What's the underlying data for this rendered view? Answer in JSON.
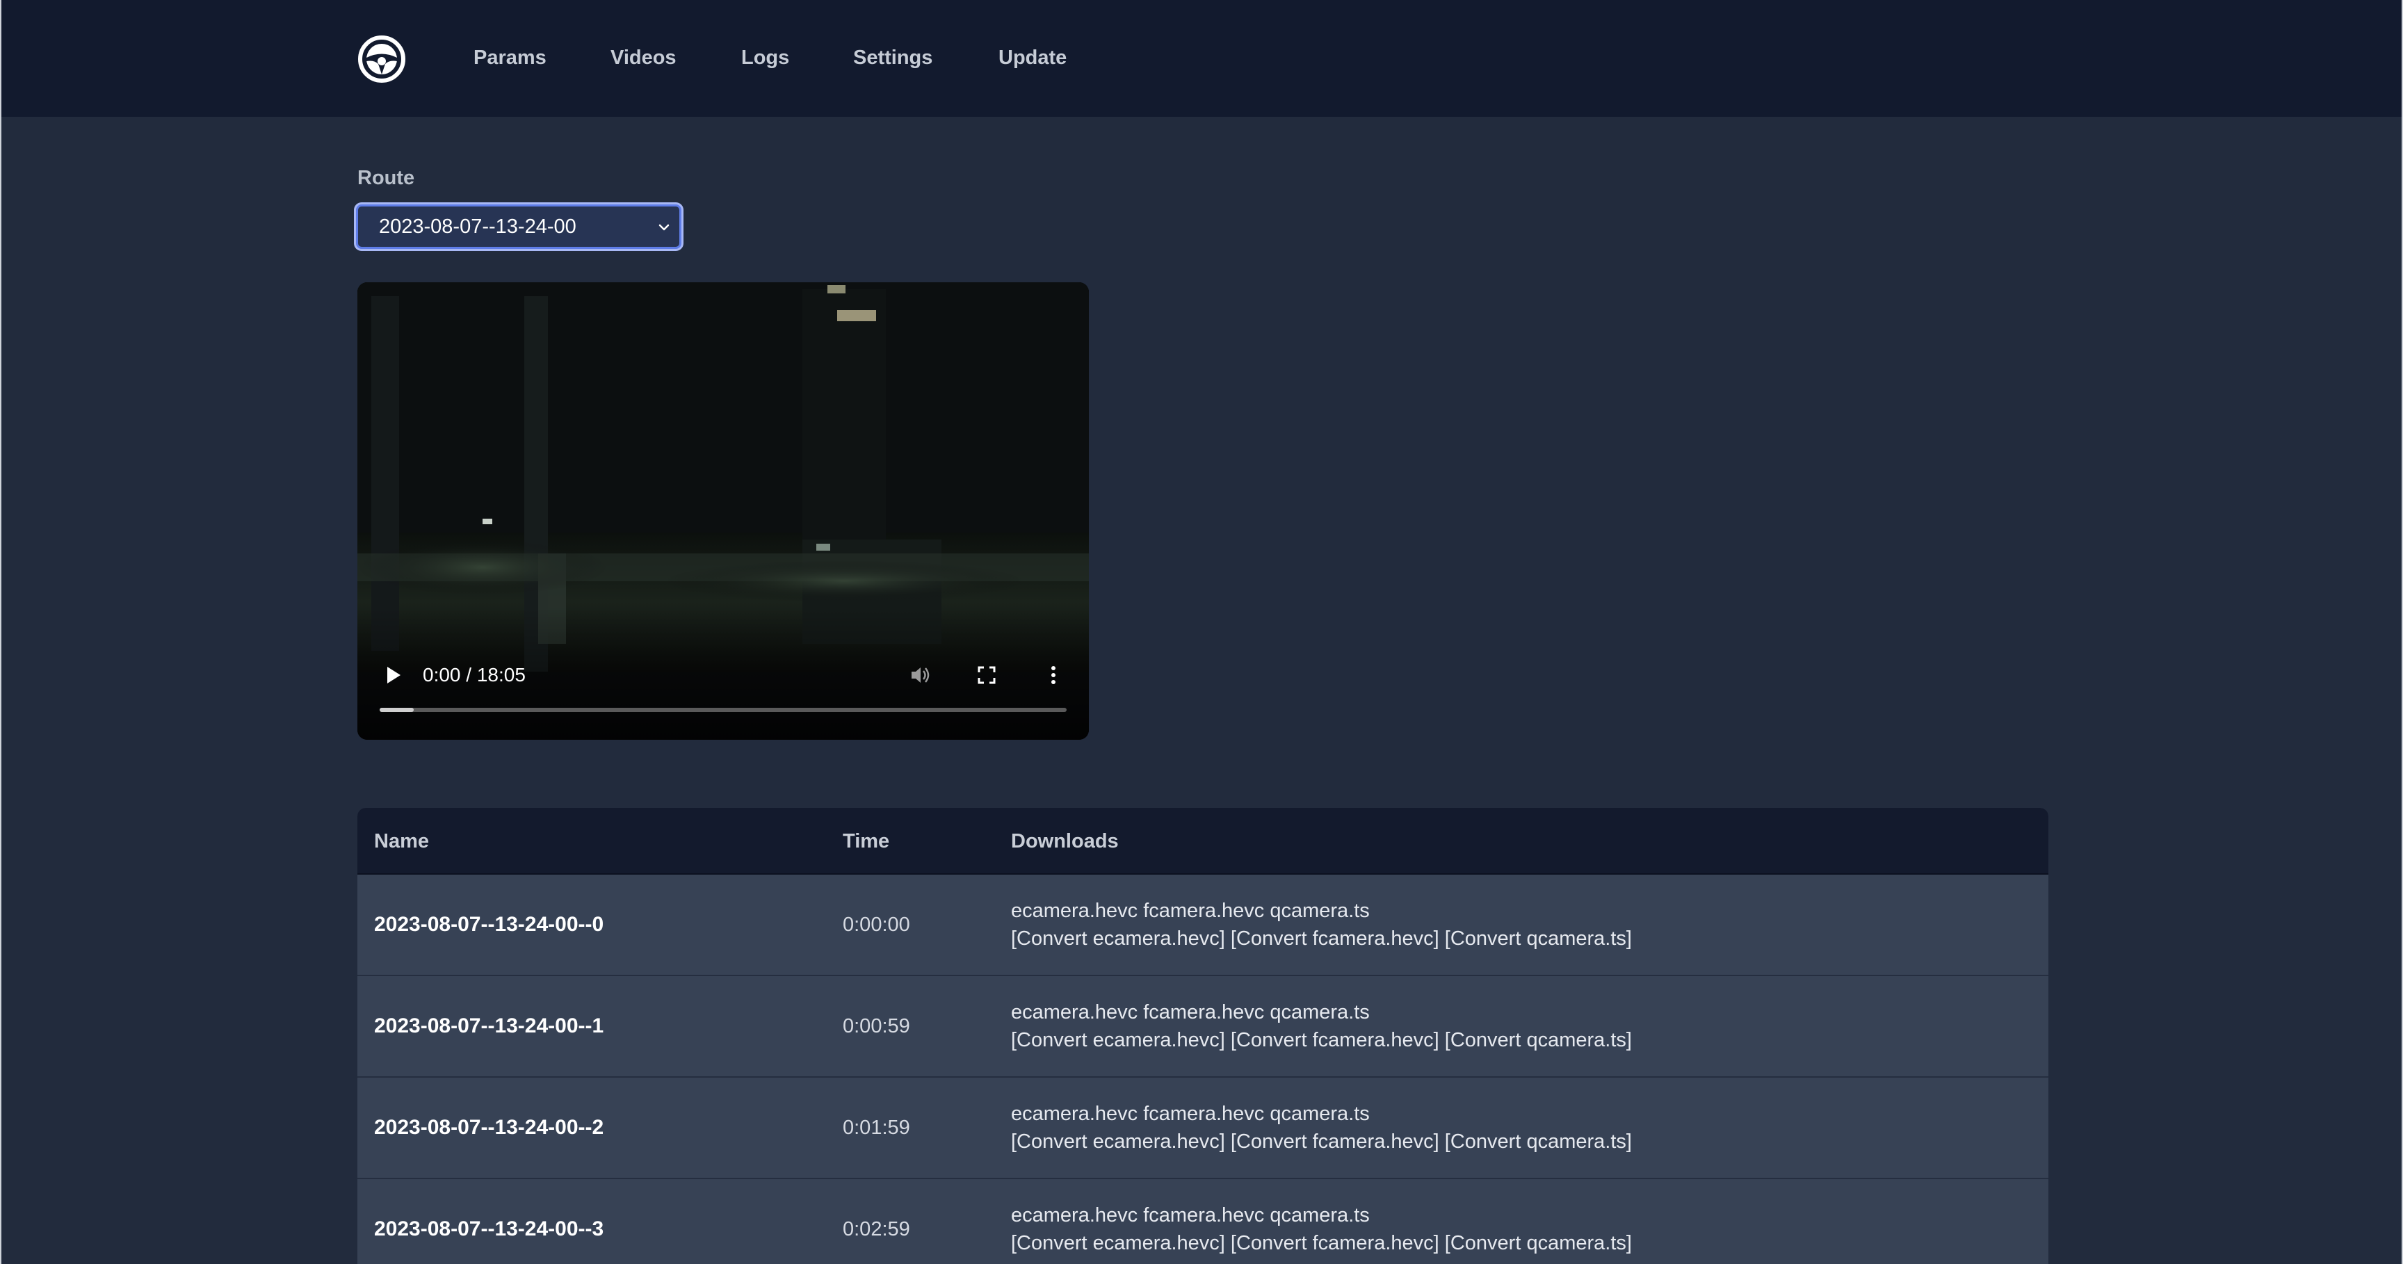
{
  "nav": {
    "logo_icon": "steering-wheel-icon",
    "items": [
      {
        "label": "Params"
      },
      {
        "label": "Videos"
      },
      {
        "label": "Logs"
      },
      {
        "label": "Settings"
      },
      {
        "label": "Update"
      }
    ]
  },
  "route": {
    "label": "Route",
    "selected": "2023-08-07--13-24-00"
  },
  "video": {
    "time": "0:00 / 18:05",
    "buffered_fraction": 0.05,
    "icons": [
      "play-icon",
      "volume-icon",
      "fullscreen-icon",
      "more-vert-icon"
    ]
  },
  "table": {
    "headers": {
      "name": "Name",
      "time": "Time",
      "downloads": "Downloads"
    },
    "rows": [
      {
        "name": "2023-08-07--13-24-00--0",
        "time": "0:00:00",
        "files": [
          "ecamera.hevc",
          "fcamera.hevc",
          "qcamera.ts"
        ],
        "converts": [
          "[Convert ecamera.hevc]",
          "[Convert fcamera.hevc]",
          "[Convert qcamera.ts]"
        ]
      },
      {
        "name": "2023-08-07--13-24-00--1",
        "time": "0:00:59",
        "files": [
          "ecamera.hevc",
          "fcamera.hevc",
          "qcamera.ts"
        ],
        "converts": [
          "[Convert ecamera.hevc]",
          "[Convert fcamera.hevc]",
          "[Convert qcamera.ts]"
        ]
      },
      {
        "name": "2023-08-07--13-24-00--2",
        "time": "0:01:59",
        "files": [
          "ecamera.hevc",
          "fcamera.hevc",
          "qcamera.ts"
        ],
        "converts": [
          "[Convert ecamera.hevc]",
          "[Convert fcamera.hevc]",
          "[Convert qcamera.ts]"
        ]
      },
      {
        "name": "2023-08-07--13-24-00--3",
        "time": "0:02:59",
        "files": [
          "ecamera.hevc",
          "fcamera.hevc",
          "qcamera.ts"
        ],
        "converts": [
          "[Convert ecamera.hevc]",
          "[Convert fcamera.hevc]",
          "[Convert qcamera.ts]"
        ]
      }
    ]
  },
  "colors": {
    "background": "#222b3d",
    "navbar": "#121a2e",
    "table_header": "#131a2d",
    "table_row": "#374255",
    "select_border": "#5f7de8"
  }
}
